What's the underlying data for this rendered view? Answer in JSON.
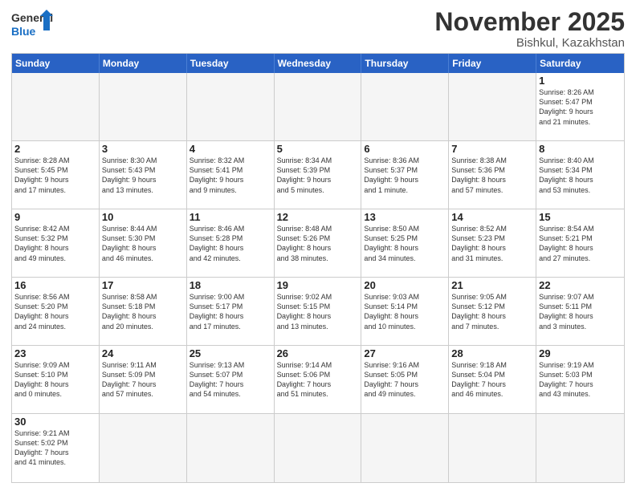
{
  "header": {
    "logo_general": "General",
    "logo_blue": "Blue",
    "month": "November 2025",
    "location": "Bishkul, Kazakhstan"
  },
  "weekdays": [
    "Sunday",
    "Monday",
    "Tuesday",
    "Wednesday",
    "Thursday",
    "Friday",
    "Saturday"
  ],
  "weeks": [
    [
      {
        "day": "",
        "data": ""
      },
      {
        "day": "",
        "data": ""
      },
      {
        "day": "",
        "data": ""
      },
      {
        "day": "",
        "data": ""
      },
      {
        "day": "",
        "data": ""
      },
      {
        "day": "",
        "data": ""
      },
      {
        "day": "1",
        "data": "Sunrise: 8:26 AM\nSunset: 5:47 PM\nDaylight: 9 hours\nand 21 minutes."
      }
    ],
    [
      {
        "day": "2",
        "data": "Sunrise: 8:28 AM\nSunset: 5:45 PM\nDaylight: 9 hours\nand 17 minutes."
      },
      {
        "day": "3",
        "data": "Sunrise: 8:30 AM\nSunset: 5:43 PM\nDaylight: 9 hours\nand 13 minutes."
      },
      {
        "day": "4",
        "data": "Sunrise: 8:32 AM\nSunset: 5:41 PM\nDaylight: 9 hours\nand 9 minutes."
      },
      {
        "day": "5",
        "data": "Sunrise: 8:34 AM\nSunset: 5:39 PM\nDaylight: 9 hours\nand 5 minutes."
      },
      {
        "day": "6",
        "data": "Sunrise: 8:36 AM\nSunset: 5:37 PM\nDaylight: 9 hours\nand 1 minute."
      },
      {
        "day": "7",
        "data": "Sunrise: 8:38 AM\nSunset: 5:36 PM\nDaylight: 8 hours\nand 57 minutes."
      },
      {
        "day": "8",
        "data": "Sunrise: 8:40 AM\nSunset: 5:34 PM\nDaylight: 8 hours\nand 53 minutes."
      }
    ],
    [
      {
        "day": "9",
        "data": "Sunrise: 8:42 AM\nSunset: 5:32 PM\nDaylight: 8 hours\nand 49 minutes."
      },
      {
        "day": "10",
        "data": "Sunrise: 8:44 AM\nSunset: 5:30 PM\nDaylight: 8 hours\nand 46 minutes."
      },
      {
        "day": "11",
        "data": "Sunrise: 8:46 AM\nSunset: 5:28 PM\nDaylight: 8 hours\nand 42 minutes."
      },
      {
        "day": "12",
        "data": "Sunrise: 8:48 AM\nSunset: 5:26 PM\nDaylight: 8 hours\nand 38 minutes."
      },
      {
        "day": "13",
        "data": "Sunrise: 8:50 AM\nSunset: 5:25 PM\nDaylight: 8 hours\nand 34 minutes."
      },
      {
        "day": "14",
        "data": "Sunrise: 8:52 AM\nSunset: 5:23 PM\nDaylight: 8 hours\nand 31 minutes."
      },
      {
        "day": "15",
        "data": "Sunrise: 8:54 AM\nSunset: 5:21 PM\nDaylight: 8 hours\nand 27 minutes."
      }
    ],
    [
      {
        "day": "16",
        "data": "Sunrise: 8:56 AM\nSunset: 5:20 PM\nDaylight: 8 hours\nand 24 minutes."
      },
      {
        "day": "17",
        "data": "Sunrise: 8:58 AM\nSunset: 5:18 PM\nDaylight: 8 hours\nand 20 minutes."
      },
      {
        "day": "18",
        "data": "Sunrise: 9:00 AM\nSunset: 5:17 PM\nDaylight: 8 hours\nand 17 minutes."
      },
      {
        "day": "19",
        "data": "Sunrise: 9:02 AM\nSunset: 5:15 PM\nDaylight: 8 hours\nand 13 minutes."
      },
      {
        "day": "20",
        "data": "Sunrise: 9:03 AM\nSunset: 5:14 PM\nDaylight: 8 hours\nand 10 minutes."
      },
      {
        "day": "21",
        "data": "Sunrise: 9:05 AM\nSunset: 5:12 PM\nDaylight: 8 hours\nand 7 minutes."
      },
      {
        "day": "22",
        "data": "Sunrise: 9:07 AM\nSunset: 5:11 PM\nDaylight: 8 hours\nand 3 minutes."
      }
    ],
    [
      {
        "day": "23",
        "data": "Sunrise: 9:09 AM\nSunset: 5:10 PM\nDaylight: 8 hours\nand 0 minutes."
      },
      {
        "day": "24",
        "data": "Sunrise: 9:11 AM\nSunset: 5:09 PM\nDaylight: 7 hours\nand 57 minutes."
      },
      {
        "day": "25",
        "data": "Sunrise: 9:13 AM\nSunset: 5:07 PM\nDaylight: 7 hours\nand 54 minutes."
      },
      {
        "day": "26",
        "data": "Sunrise: 9:14 AM\nSunset: 5:06 PM\nDaylight: 7 hours\nand 51 minutes."
      },
      {
        "day": "27",
        "data": "Sunrise: 9:16 AM\nSunset: 5:05 PM\nDaylight: 7 hours\nand 49 minutes."
      },
      {
        "day": "28",
        "data": "Sunrise: 9:18 AM\nSunset: 5:04 PM\nDaylight: 7 hours\nand 46 minutes."
      },
      {
        "day": "29",
        "data": "Sunrise: 9:19 AM\nSunset: 5:03 PM\nDaylight: 7 hours\nand 43 minutes."
      }
    ],
    [
      {
        "day": "30",
        "data": "Sunrise: 9:21 AM\nSunset: 5:02 PM\nDaylight: 7 hours\nand 41 minutes."
      },
      {
        "day": "",
        "data": ""
      },
      {
        "day": "",
        "data": ""
      },
      {
        "day": "",
        "data": ""
      },
      {
        "day": "",
        "data": ""
      },
      {
        "day": "",
        "data": ""
      },
      {
        "day": "",
        "data": ""
      }
    ]
  ]
}
